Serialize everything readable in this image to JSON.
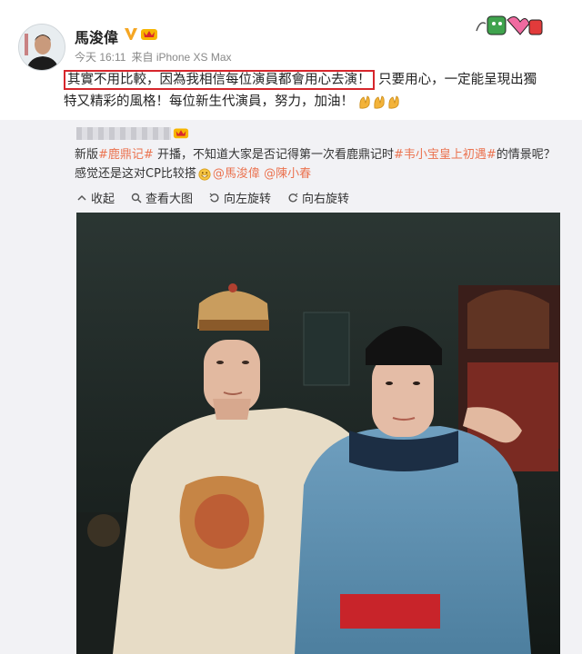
{
  "header": {
    "username": "馬浚偉",
    "time": "今天 16:11",
    "source": "来自 iPhone XS Max"
  },
  "post": {
    "highlighted_text": "其實不用比較，因為我相信每位演員都會用心去演！",
    "rest_line1": "只要用心，一定能呈現出獨",
    "line2": "特又精彩的風格！每位新生代演員，努力，加油！"
  },
  "repost": {
    "text_start": "新版",
    "tag1": "#鹿鼎记#",
    "text_mid": " 开播，不知道大家是否记得第一次看鹿鼎记时",
    "tag2": "#韦小宝皇上初遇#",
    "text_after": "的情景呢？感觉还是这对CP比较搭",
    "mention1": "@馬浚偉",
    "mention2": "@陳小春"
  },
  "actions": {
    "collapse": "收起",
    "view_large": "查看大图",
    "rotate_left": "向左旋转",
    "rotate_right": "向右旋转"
  },
  "colors": {
    "highlight_border": "#d6262c",
    "link": "#eb7350",
    "repost_bg": "#f2f2f5"
  }
}
